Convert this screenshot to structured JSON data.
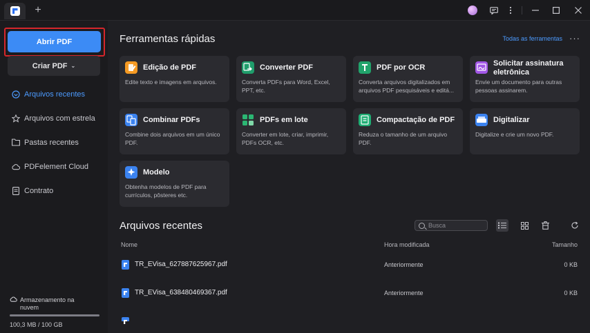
{
  "titlebar": {
    "new_tab_symbol": "+"
  },
  "sidebar": {
    "open_pdf": "Abrir PDF",
    "create_pdf": "Criar PDF",
    "items": [
      {
        "label": "Arquivos recentes",
        "icon": "recent-icon",
        "active": true
      },
      {
        "label": "Arquivos com estrela",
        "icon": "star-icon",
        "active": false
      },
      {
        "label": "Pastas recentes",
        "icon": "folder-icon",
        "active": false
      },
      {
        "label": "PDFelement Cloud",
        "icon": "cloud-icon",
        "active": false
      },
      {
        "label": "Contrato",
        "icon": "contract-icon",
        "active": false
      }
    ],
    "storage": {
      "label": "Armazenamento na nuvem",
      "usage_text": "100,3 MB / 100 GB",
      "used_fraction": 1.0
    }
  },
  "quick_tools": {
    "title": "Ferramentas rápidas",
    "all_tools": "Todas as ferramentas",
    "cards": [
      {
        "title": "Edição de PDF",
        "desc": "Edite texto e imagens em arquivos.",
        "icon": "edit-pdf-icon",
        "color": "#f59a23"
      },
      {
        "title": "Converter PDF",
        "desc": "Converta PDFs para Word, Excel, PPT, etc.",
        "icon": "convert-pdf-icon",
        "color": "#1f9d6b"
      },
      {
        "title": "PDF por OCR",
        "desc": "Converta arquivos digitalizados em arquivos PDF pesquisáveis e editá...",
        "icon": "ocr-icon",
        "color": "#21a36b"
      },
      {
        "title": "Solicitar assinatura eletrônica",
        "desc": "Envie um documento para outras pessoas assinarem.",
        "icon": "esign-icon",
        "color": "#a257e6"
      },
      {
        "title": "Combinar PDFs",
        "desc": "Combine dois arquivos em um único PDF.",
        "icon": "combine-icon",
        "color": "#3b83f0"
      },
      {
        "title": "PDFs em lote",
        "desc": "Converter em lote, criar, imprimir, PDFs OCR, etc.",
        "icon": "batch-icon",
        "color": "#2bb673"
      },
      {
        "title": "Compactação de PDF",
        "desc": "Reduza o tamanho de um arquivo PDF.",
        "icon": "compress-icon",
        "color": "#1fae74"
      },
      {
        "title": "Digitalizar",
        "desc": "Digitalize e crie um novo PDF.",
        "icon": "scan-icon",
        "color": "#3b83f0"
      },
      {
        "title": "Modelo",
        "desc": "Obtenha modelos de PDF para currículos, pôsteres etc.",
        "icon": "template-icon",
        "color": "#3b83f0"
      }
    ]
  },
  "recent": {
    "title": "Arquivos recentes",
    "search_placeholder": "Busca",
    "columns": {
      "name": "Nome",
      "modified": "Hora modificada",
      "size": "Tamanho"
    },
    "files": [
      {
        "name": "TR_EVisa_627887625967.pdf",
        "modified": "Anteriormente",
        "size": "0 KB"
      },
      {
        "name": "TR_EVisa_638480469367.pdf",
        "modified": "Anteriormente",
        "size": "0 KB"
      }
    ]
  }
}
